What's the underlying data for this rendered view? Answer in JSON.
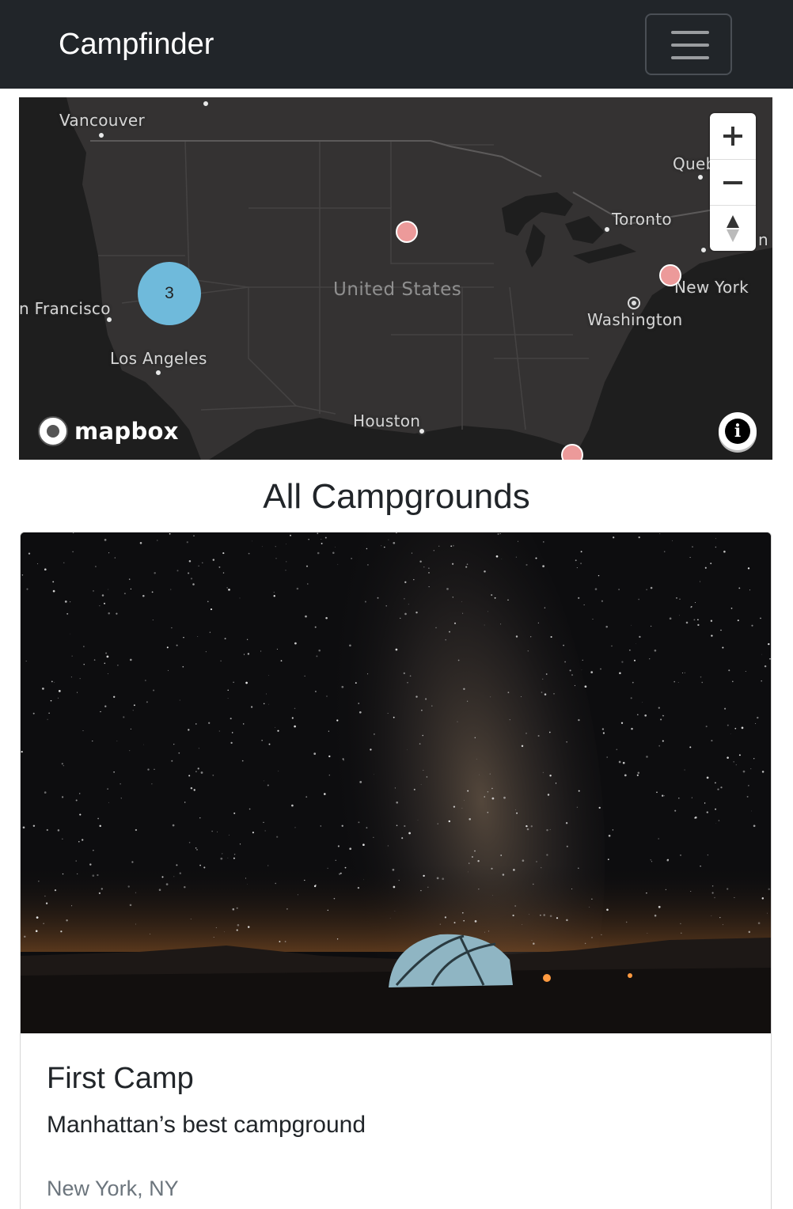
{
  "navbar": {
    "brand": "Campfinder",
    "toggler_icon": "hamburger-menu-icon"
  },
  "map": {
    "cities": {
      "vancouver": "Vancouver",
      "san_francisco": "n Francisco",
      "los_angeles": "Los Angeles",
      "houston": "Houston",
      "toronto": "Toronto",
      "quebec": "Queb",
      "new_york": "New York",
      "washington": "Washington",
      "boston_partial": "n"
    },
    "country": "United States",
    "cluster_count": "3",
    "controls": {
      "zoom_in_icon": "plus-icon",
      "zoom_out_icon": "minus-icon",
      "compass_icon": "compass-icon"
    },
    "attribution_logo": "mapbox",
    "info_icon": "i",
    "colors": {
      "map_background": "#343232",
      "pin": "#ec9a9a",
      "cluster": "#6fbadb"
    }
  },
  "page": {
    "heading": "All Campgrounds"
  },
  "campgrounds": [
    {
      "image_alt": "tent under milky way night sky",
      "title": "First Camp",
      "description": "Manhattan’s best campground",
      "location": "New York, NY"
    }
  ]
}
